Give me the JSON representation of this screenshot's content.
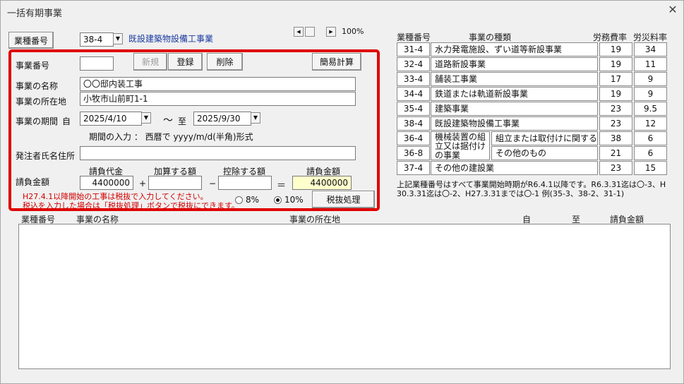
{
  "window": {
    "title": "一括有期事業",
    "close_glyph": "✕"
  },
  "top": {
    "category_button": "業種番号",
    "category_value": "38-4",
    "category_name": "既設建築物設備工事業",
    "zoom": "100%"
  },
  "form": {
    "project_number_label": "事業番号",
    "project_number_value": "",
    "new_button": "新規",
    "register_button": "登録",
    "delete_button": "削除",
    "simple_calc_button": "簡易計算",
    "name_label": "事業の名称",
    "name_value": "〇〇邸内装工事",
    "location_label": "事業の所在地",
    "location_value": "小牧市山前町1-1",
    "period_label": "事業の期間",
    "from_label": "自",
    "from_value": "2025/4/10",
    "tilde": "～",
    "to_label": "至",
    "to_value": "2025/9/30",
    "period_hint": "期間の入力 ： 西暦で yyyy/m/d(半角)形式",
    "client_label": "発注者氏名住所",
    "client_value": "",
    "contract_amount_label": "請負金額",
    "col_contract_price": "請負代金",
    "col_add": "加算する額",
    "col_deduct": "控除する額",
    "col_result": "請負金額",
    "contract_price_value": "4400000",
    "add_value": "",
    "deduct_value": "",
    "result_value": "4400000",
    "op_plus": "+",
    "op_minus": "−",
    "op_equal": "＝",
    "note_line1": "H27.4.1以降開始の工事は税抜で入力してください。",
    "note_line2": "税込を入力した場合は「税抜処理」ボタンで税抜にできます。",
    "tax8_label": "8%",
    "tax10_label": "10%",
    "tax_button": "税抜処理"
  },
  "rate_table": {
    "headers": {
      "code": "業種番号",
      "type": "事業の種類",
      "labor": "労務費率",
      "accident": "労災料率"
    },
    "rows": [
      {
        "code": "31-4",
        "type": "水力発電施設、ずい道等新設事業",
        "labor": "19",
        "accident": "34"
      },
      {
        "code": "32-4",
        "type": "道路新設事業",
        "labor": "19",
        "accident": "11"
      },
      {
        "code": "33-4",
        "type": "舗装工事業",
        "labor": "17",
        "accident": "9"
      },
      {
        "code": "34-4",
        "type": "鉄道または軌道新設事業",
        "labor": "19",
        "accident": "9"
      },
      {
        "code": "35-4",
        "type": "建築事業",
        "labor": "23",
        "accident": "9.5"
      },
      {
        "code": "38-4",
        "type": "既設建築物設備工事業",
        "labor": "23",
        "accident": "12"
      }
    ],
    "machine": {
      "group_label": "機械装置の組立又は据付けの事業",
      "sub1_code": "36-4",
      "sub1_type": "組立または取付けに関するもの",
      "sub1_labor": "38",
      "sub1_accident": "6",
      "sub2_code": "36-8",
      "sub2_type": "その他のもの",
      "sub2_labor": "21",
      "sub2_accident": "6"
    },
    "last_row": {
      "code": "37-4",
      "type": "その他の建設業",
      "labor": "23",
      "accident": "15"
    },
    "note_line1": "上記業種番号はすべて事業開始時期がR6.4.1以降です。R6.3.31迄は〇-3、H",
    "note_line2": "30.3.31迄は〇-2、H27.3.31までは〇-1  例(35-3、38-2、31-1)"
  },
  "list": {
    "headers": {
      "code": "業種番号",
      "name": "事業の名称",
      "location": "事業の所在地",
      "from": "自",
      "to": "至",
      "amount": "請負金額"
    }
  }
}
